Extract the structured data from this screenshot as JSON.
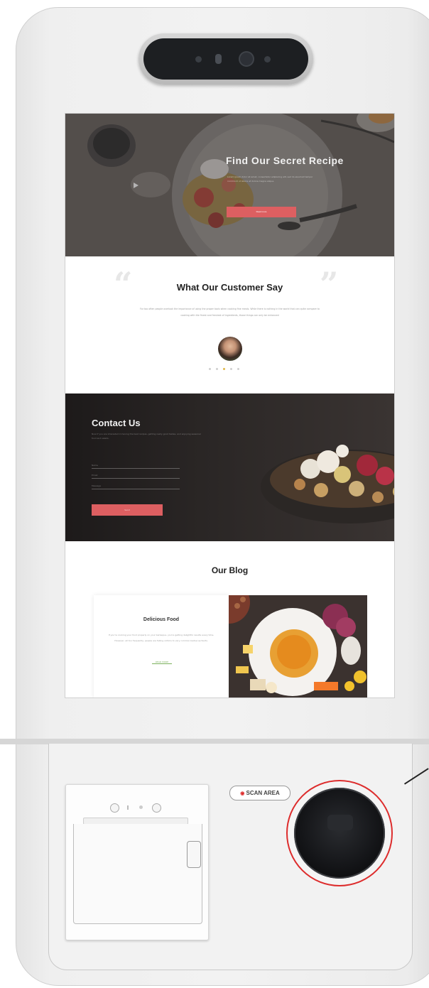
{
  "hero": {
    "title": "Find Our Secret Recipe",
    "text": "Lorem ipsum dolor sit amet, consectetur adipiscing elit, sed do eiusmod tempor incididunt ut labore et dolore magna aliqua.",
    "button_label": "Read more"
  },
  "testimonials": {
    "title": "What Our Customer Say",
    "text": "For too often people overlook the importance of using the proper tools when cooking fine meals. While there is nothing in the world that can quite compare to cooking with the finest and freshest of ingredients, those things can only be enhanced",
    "dot_count": 5,
    "active_dot_index": 2
  },
  "contact": {
    "title": "Contact Us",
    "text": "Now if you are interested in having the best recipes, getting really good tastes, and enjoying seasonal food and salads.",
    "fields": {
      "name_placeholder": "Name",
      "email_placeholder": "Email",
      "message_placeholder": "Message"
    },
    "button_label": "Send"
  },
  "blog": {
    "title": "Our Blog",
    "post": {
      "title": "Delicious Food",
      "text": "If you're cooking your food properly on your barbeque, you're getting delightful results every time. However, all too frequently, people are falling victims to very common barbecue faults.",
      "read_more": "READ MORE"
    }
  },
  "kiosk": {
    "scan_area_label": "SCAN AREA"
  },
  "colors": {
    "accent": "#dd5f61",
    "scanner_ring": "#dd2c2c",
    "read_more": "#7ab05b"
  }
}
